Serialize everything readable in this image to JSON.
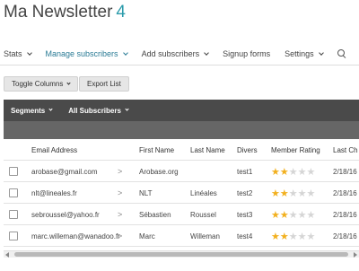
{
  "header": {
    "title": "Ma Newsletter",
    "count": "4"
  },
  "nav": {
    "items": [
      {
        "label": "Stats",
        "has_dropdown": true,
        "active": false
      },
      {
        "label": "Manage subscribers",
        "has_dropdown": true,
        "active": true
      },
      {
        "label": "Add subscribers",
        "has_dropdown": true,
        "active": false
      },
      {
        "label": "Signup forms",
        "has_dropdown": false,
        "active": false
      },
      {
        "label": "Settings",
        "has_dropdown": true,
        "active": false
      }
    ],
    "search_icon": "search-icon"
  },
  "actions": {
    "toggle_columns": "Toggle Columns",
    "export_list": "Export List"
  },
  "toolbar": {
    "segments": "Segments",
    "all_subscribers": "All Subscribers"
  },
  "table": {
    "columns": {
      "email": "Email Address",
      "first": "First Name",
      "last": "Last Name",
      "divers": "Divers",
      "rating": "Member Rating",
      "change": "Last Ch"
    },
    "rows": [
      {
        "email": "arobase@gmail.com",
        "first": "Arobase.org",
        "last": "",
        "divers": "test1",
        "rating": 2,
        "change": "2/18/16"
      },
      {
        "email": "nlt@lineales.fr",
        "first": "NLT",
        "last": "Linéales",
        "divers": "test2",
        "rating": 2,
        "change": "2/18/16"
      },
      {
        "email": "sebroussel@yahoo.fr",
        "first": "Sébastien",
        "last": "Roussel",
        "divers": "test3",
        "rating": 2,
        "change": "2/18/16"
      },
      {
        "email": "marc.willeman@wanadoo.fr",
        "first": "Marc",
        "last": "Willeman",
        "divers": "test4",
        "rating": 2,
        "change": "2/18/16"
      }
    ]
  },
  "colors": {
    "accent": "#2a7b95",
    "count": "#2b9bab",
    "toolbar": "#4a4a4a",
    "star": "#f2b01e"
  }
}
